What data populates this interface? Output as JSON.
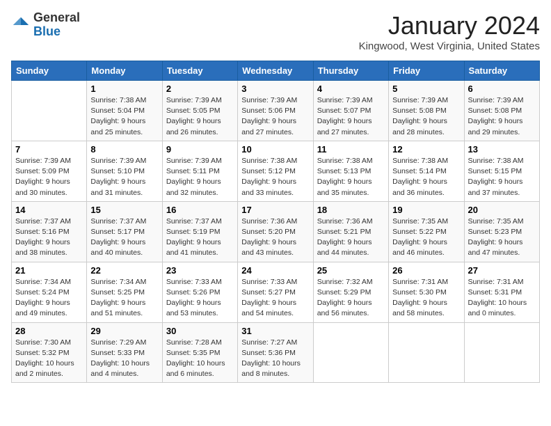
{
  "logo": {
    "general": "General",
    "blue": "Blue"
  },
  "title": "January 2024",
  "location": "Kingwood, West Virginia, United States",
  "days_of_week": [
    "Sunday",
    "Monday",
    "Tuesday",
    "Wednesday",
    "Thursday",
    "Friday",
    "Saturday"
  ],
  "weeks": [
    [
      {
        "day": "",
        "info": ""
      },
      {
        "day": "1",
        "info": "Sunrise: 7:38 AM\nSunset: 5:04 PM\nDaylight: 9 hours\nand 25 minutes."
      },
      {
        "day": "2",
        "info": "Sunrise: 7:39 AM\nSunset: 5:05 PM\nDaylight: 9 hours\nand 26 minutes."
      },
      {
        "day": "3",
        "info": "Sunrise: 7:39 AM\nSunset: 5:06 PM\nDaylight: 9 hours\nand 27 minutes."
      },
      {
        "day": "4",
        "info": "Sunrise: 7:39 AM\nSunset: 5:07 PM\nDaylight: 9 hours\nand 27 minutes."
      },
      {
        "day": "5",
        "info": "Sunrise: 7:39 AM\nSunset: 5:08 PM\nDaylight: 9 hours\nand 28 minutes."
      },
      {
        "day": "6",
        "info": "Sunrise: 7:39 AM\nSunset: 5:08 PM\nDaylight: 9 hours\nand 29 minutes."
      }
    ],
    [
      {
        "day": "7",
        "info": "Sunrise: 7:39 AM\nSunset: 5:09 PM\nDaylight: 9 hours\nand 30 minutes."
      },
      {
        "day": "8",
        "info": "Sunrise: 7:39 AM\nSunset: 5:10 PM\nDaylight: 9 hours\nand 31 minutes."
      },
      {
        "day": "9",
        "info": "Sunrise: 7:39 AM\nSunset: 5:11 PM\nDaylight: 9 hours\nand 32 minutes."
      },
      {
        "day": "10",
        "info": "Sunrise: 7:38 AM\nSunset: 5:12 PM\nDaylight: 9 hours\nand 33 minutes."
      },
      {
        "day": "11",
        "info": "Sunrise: 7:38 AM\nSunset: 5:13 PM\nDaylight: 9 hours\nand 35 minutes."
      },
      {
        "day": "12",
        "info": "Sunrise: 7:38 AM\nSunset: 5:14 PM\nDaylight: 9 hours\nand 36 minutes."
      },
      {
        "day": "13",
        "info": "Sunrise: 7:38 AM\nSunset: 5:15 PM\nDaylight: 9 hours\nand 37 minutes."
      }
    ],
    [
      {
        "day": "14",
        "info": "Sunrise: 7:37 AM\nSunset: 5:16 PM\nDaylight: 9 hours\nand 38 minutes."
      },
      {
        "day": "15",
        "info": "Sunrise: 7:37 AM\nSunset: 5:17 PM\nDaylight: 9 hours\nand 40 minutes."
      },
      {
        "day": "16",
        "info": "Sunrise: 7:37 AM\nSunset: 5:19 PM\nDaylight: 9 hours\nand 41 minutes."
      },
      {
        "day": "17",
        "info": "Sunrise: 7:36 AM\nSunset: 5:20 PM\nDaylight: 9 hours\nand 43 minutes."
      },
      {
        "day": "18",
        "info": "Sunrise: 7:36 AM\nSunset: 5:21 PM\nDaylight: 9 hours\nand 44 minutes."
      },
      {
        "day": "19",
        "info": "Sunrise: 7:35 AM\nSunset: 5:22 PM\nDaylight: 9 hours\nand 46 minutes."
      },
      {
        "day": "20",
        "info": "Sunrise: 7:35 AM\nSunset: 5:23 PM\nDaylight: 9 hours\nand 47 minutes."
      }
    ],
    [
      {
        "day": "21",
        "info": "Sunrise: 7:34 AM\nSunset: 5:24 PM\nDaylight: 9 hours\nand 49 minutes."
      },
      {
        "day": "22",
        "info": "Sunrise: 7:34 AM\nSunset: 5:25 PM\nDaylight: 9 hours\nand 51 minutes."
      },
      {
        "day": "23",
        "info": "Sunrise: 7:33 AM\nSunset: 5:26 PM\nDaylight: 9 hours\nand 53 minutes."
      },
      {
        "day": "24",
        "info": "Sunrise: 7:33 AM\nSunset: 5:27 PM\nDaylight: 9 hours\nand 54 minutes."
      },
      {
        "day": "25",
        "info": "Sunrise: 7:32 AM\nSunset: 5:29 PM\nDaylight: 9 hours\nand 56 minutes."
      },
      {
        "day": "26",
        "info": "Sunrise: 7:31 AM\nSunset: 5:30 PM\nDaylight: 9 hours\nand 58 minutes."
      },
      {
        "day": "27",
        "info": "Sunrise: 7:31 AM\nSunset: 5:31 PM\nDaylight: 10 hours\nand 0 minutes."
      }
    ],
    [
      {
        "day": "28",
        "info": "Sunrise: 7:30 AM\nSunset: 5:32 PM\nDaylight: 10 hours\nand 2 minutes."
      },
      {
        "day": "29",
        "info": "Sunrise: 7:29 AM\nSunset: 5:33 PM\nDaylight: 10 hours\nand 4 minutes."
      },
      {
        "day": "30",
        "info": "Sunrise: 7:28 AM\nSunset: 5:35 PM\nDaylight: 10 hours\nand 6 minutes."
      },
      {
        "day": "31",
        "info": "Sunrise: 7:27 AM\nSunset: 5:36 PM\nDaylight: 10 hours\nand 8 minutes."
      },
      {
        "day": "",
        "info": ""
      },
      {
        "day": "",
        "info": ""
      },
      {
        "day": "",
        "info": ""
      }
    ]
  ]
}
